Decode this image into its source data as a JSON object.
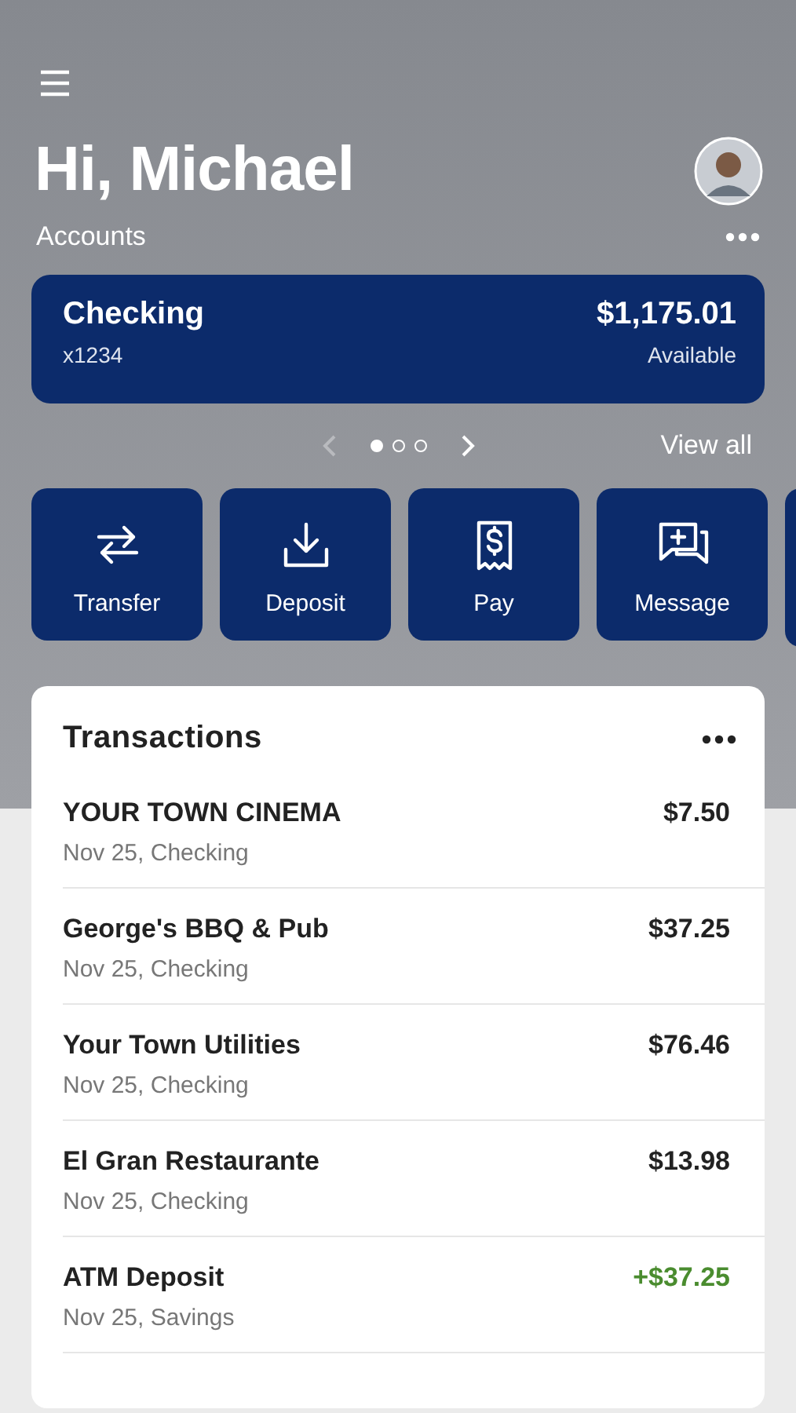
{
  "header": {
    "greeting": "Hi, Michael"
  },
  "accounts": {
    "title": "Accounts",
    "view_all": "View all",
    "cards": [
      {
        "name": "Checking",
        "number": "x1234",
        "balance": "$1,175.01",
        "balance_label": "Available"
      }
    ],
    "pager": {
      "prev_disabled": true,
      "dots": [
        {
          "selected": true
        },
        {
          "selected": false
        },
        {
          "selected": false
        }
      ]
    }
  },
  "actions": [
    {
      "kind": "transfer",
      "label": "Transfer"
    },
    {
      "kind": "deposit",
      "label": "Deposit"
    },
    {
      "kind": "pay",
      "label": "Pay"
    },
    {
      "kind": "message",
      "label": "Message"
    }
  ],
  "transactions": {
    "title": "Transactions",
    "rows": [
      {
        "name": "YOUR TOWN CINEMA",
        "detail": "Nov 25, Checking",
        "amount": "$7.50",
        "kind": "debit"
      },
      {
        "name": "George's BBQ & Pub",
        "detail": "Nov 25, Checking",
        "amount": "$37.25",
        "kind": "debit"
      },
      {
        "name": "Your Town Utilities",
        "detail": "Nov 25, Checking",
        "amount": "$76.46",
        "kind": "debit"
      },
      {
        "name": "El Gran Restaurante",
        "detail": "Nov 25, Checking",
        "amount": "$13.98",
        "kind": "debit"
      },
      {
        "name": "ATM Deposit",
        "detail": "Nov 25, Savings",
        "amount": "+$37.25",
        "kind": "credit"
      }
    ]
  }
}
